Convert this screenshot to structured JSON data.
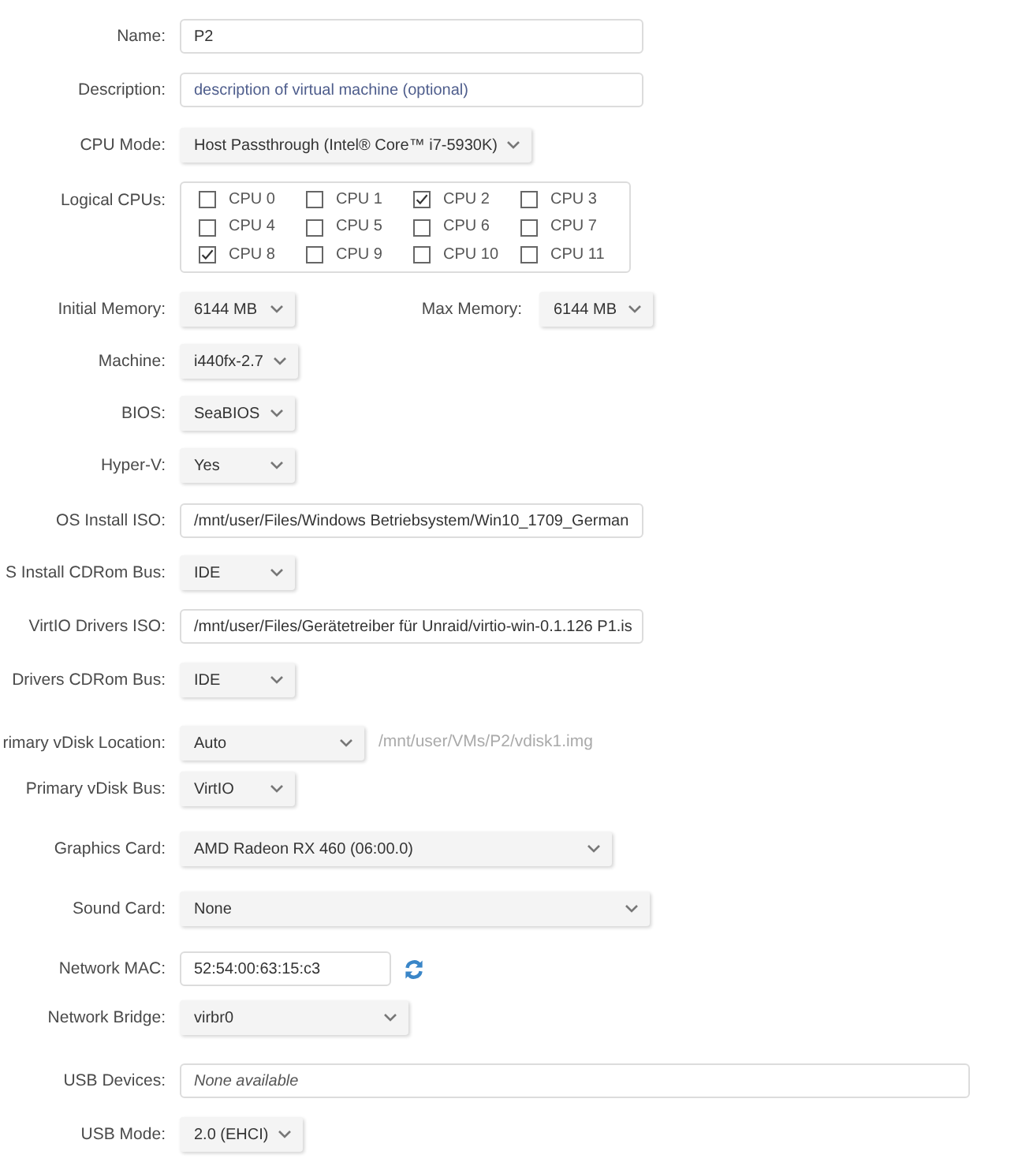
{
  "form": {
    "rows": [
      {
        "kind": "input",
        "label": "Name:",
        "value": "P2"
      },
      {
        "kind": "input",
        "label": "Description:",
        "placeholder": "description of virtual machine (optional)"
      },
      {
        "kind": "select",
        "label": "CPU Mode:",
        "value": "Host Passthrough (Intel® Core™ i7-5930K)"
      },
      {
        "kind": "checkboxes",
        "label": "Logical CPUs:",
        "options": [
          {
            "label": "CPU 0",
            "checked": false
          },
          {
            "label": "CPU 1",
            "checked": false
          },
          {
            "label": "CPU 2",
            "checked": true
          },
          {
            "label": "CPU 3",
            "checked": false
          },
          {
            "label": "CPU 4",
            "checked": false
          },
          {
            "label": "CPU 5",
            "checked": false
          },
          {
            "label": "CPU 6",
            "checked": false
          },
          {
            "label": "CPU 7",
            "checked": false
          },
          {
            "label": "CPU 8",
            "checked": true
          },
          {
            "label": "CPU 9",
            "checked": false
          },
          {
            "label": "CPU 10",
            "checked": false
          },
          {
            "label": "CPU 11",
            "checked": false
          }
        ]
      },
      {
        "kind": "selectpair",
        "label": "Initial Memory:",
        "value": "6144 MB",
        "second_label": "Max Memory:",
        "second_value": "6144 MB"
      },
      {
        "kind": "select",
        "label": "Machine:",
        "value": "i440fx-2.7"
      },
      {
        "kind": "select",
        "label": "BIOS:",
        "value": "SeaBIOS"
      },
      {
        "kind": "select",
        "label": "Hyper-V:",
        "value": "Yes"
      },
      {
        "kind": "input",
        "label": "OS Install ISO:",
        "value": "/mnt/user/Files/Windows Betriebsystem/Win10_1709_German"
      },
      {
        "kind": "select",
        "label": "S Install CDRom Bus:",
        "value": "IDE"
      },
      {
        "kind": "input",
        "label": "VirtIO Drivers ISO:",
        "value": "/mnt/user/Files/Gerätetreiber für Unraid/virtio-win-0.1.126 P1.is"
      },
      {
        "kind": "select",
        "label": "Drivers CDRom Bus:",
        "value": "IDE"
      },
      {
        "kind": "select",
        "label": "rimary vDisk Location:",
        "value": "Auto",
        "note": "/mnt/user/VMs/P2/vdisk1.img"
      },
      {
        "kind": "select",
        "label": "Primary vDisk Bus:",
        "value": "VirtIO"
      },
      {
        "kind": "select",
        "label": "Graphics Card:",
        "value": "AMD Radeon RX 460 (06:00.0)"
      },
      {
        "kind": "select",
        "label": "Sound Card:",
        "value": "None"
      },
      {
        "kind": "refreshable",
        "label": "Network MAC:",
        "value": "52:54:00:63:15:c3"
      },
      {
        "kind": "select",
        "label": "Network Bridge:",
        "value": "virbr0"
      },
      {
        "kind": "list",
        "label": "USB Devices:",
        "value": "None available"
      },
      {
        "kind": "select",
        "label": "USB Mode:",
        "value": "2.0 (EHCI)"
      }
    ]
  }
}
